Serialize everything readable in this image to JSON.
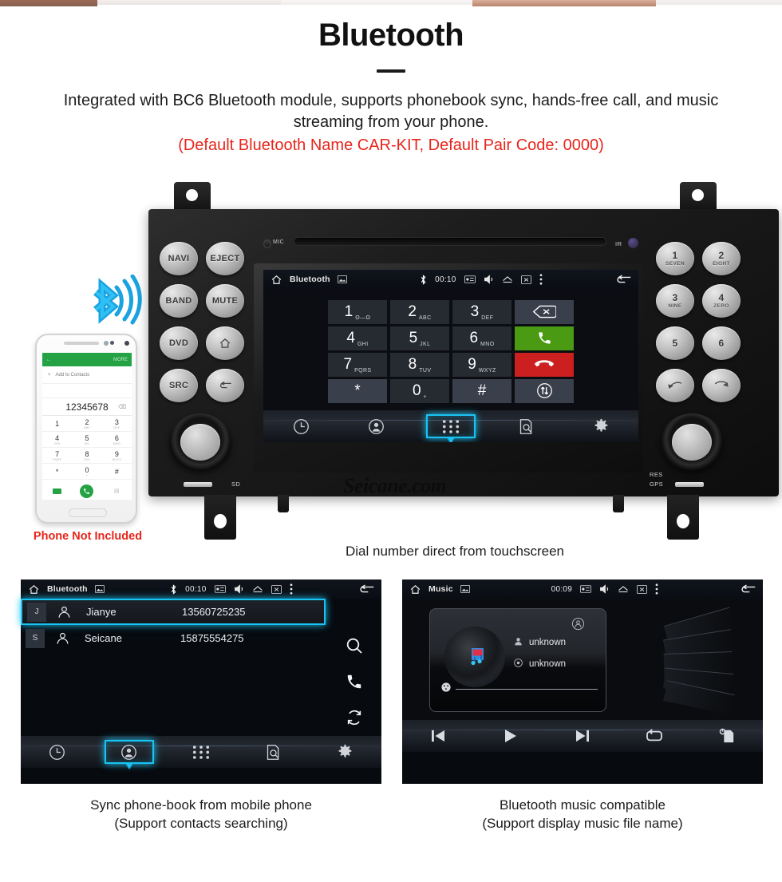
{
  "header": {
    "title": "Bluetooth",
    "subtitle_line1": "Integrated with BC6 Bluetooth module, supports phonebook sync, hands-free call, and",
    "subtitle_line2": "music streaming from your phone.",
    "subtitle_note": "(Default Bluetooth Name CAR-KIT, Default Pair Code: 0000)",
    "note_color": "#e8251b"
  },
  "phone_mockup": {
    "back_label": "←",
    "more_label": "MORE",
    "add_contact_label": "Add to Contacts",
    "dialed_number": "12345678",
    "delete_label": "⌫",
    "keys": [
      {
        "d": "1",
        "l": ""
      },
      {
        "d": "2",
        "l": "ABC"
      },
      {
        "d": "3",
        "l": "DEF"
      },
      {
        "d": "4",
        "l": "GHI"
      },
      {
        "d": "5",
        "l": "JKL"
      },
      {
        "d": "6",
        "l": "MNO"
      },
      {
        "d": "7",
        "l": "PQRS"
      },
      {
        "d": "8",
        "l": "TUV"
      },
      {
        "d": "9",
        "l": "WXYZ"
      },
      {
        "d": "*",
        "l": ""
      },
      {
        "d": "0",
        "l": "+"
      },
      {
        "d": "#",
        "l": ""
      }
    ],
    "not_included_note": "Phone Not Included"
  },
  "radio": {
    "mic_label": "MIC",
    "ir_label": "IR",
    "sd_label_left": "SD",
    "sd_label_right": "GPS",
    "res_label": "RES",
    "watermark": "Seicane.com",
    "left_buttons": [
      {
        "label": "NAVI",
        "icon": ""
      },
      {
        "label": "EJECT",
        "icon": ""
      },
      {
        "label": "BAND",
        "icon": ""
      },
      {
        "label": "MUTE",
        "icon": ""
      },
      {
        "label": "DVD",
        "icon": ""
      },
      {
        "label": "",
        "icon": "home-icon"
      },
      {
        "label": "SRC",
        "icon": ""
      },
      {
        "label": "",
        "icon": "back-icon"
      }
    ],
    "right_buttons": [
      {
        "num": "1",
        "sub": "SEVEN",
        "icon": ""
      },
      {
        "num": "2",
        "sub": "EIGHT",
        "icon": ""
      },
      {
        "num": "3",
        "sub": "NINE",
        "icon": ""
      },
      {
        "num": "4",
        "sub": "ZERO",
        "icon": ""
      },
      {
        "num": "5",
        "sub": "",
        "icon": ""
      },
      {
        "num": "6",
        "sub": "",
        "icon": ""
      },
      {
        "num": "",
        "sub": "",
        "icon": "call-answer-icon"
      },
      {
        "num": "",
        "sub": "",
        "icon": "call-end-icon"
      }
    ]
  },
  "main_screen": {
    "statusbar": {
      "title": "Bluetooth",
      "time": "00:10",
      "icons": [
        "home-icon",
        "gallery-icon",
        "bluetooth-icon",
        "radio-icon",
        "volume-icon",
        "eject-icon",
        "screen-off-icon",
        "overflow-menu-icon",
        "back-icon"
      ]
    },
    "dialpad": {
      "columns": [
        [
          {
            "d": "1",
            "l": "ʘ—ʘ"
          },
          {
            "d": "4",
            "l": "GHI"
          },
          {
            "d": "7",
            "l": "PQRS"
          },
          {
            "d": "*",
            "l": ""
          }
        ],
        [
          {
            "d": "2",
            "l": "ABC"
          },
          {
            "d": "5",
            "l": "JKL"
          },
          {
            "d": "8",
            "l": "TUV"
          },
          {
            "d": "0",
            "l": "+"
          }
        ],
        [
          {
            "d": "3",
            "l": "DEF"
          },
          {
            "d": "6",
            "l": "MNO"
          },
          {
            "d": "9",
            "l": "WXYZ"
          },
          {
            "d": "#",
            "l": ""
          }
        ]
      ],
      "actions": [
        {
          "name": "backspace-key",
          "style": "grey"
        },
        {
          "name": "call-answer-key",
          "style": "green"
        },
        {
          "name": "call-end-key",
          "style": "red"
        },
        {
          "name": "transfer-audio-key",
          "style": "grey"
        }
      ]
    },
    "navbar": {
      "items": [
        "recent-calls-icon",
        "contacts-icon",
        "dialpad-icon",
        "search-contacts-icon",
        "settings-icon"
      ],
      "selected_index": 2
    },
    "caption": "Dial number direct from touchscreen"
  },
  "phonebook_panel": {
    "statusbar": {
      "title": "Bluetooth",
      "time": "00:10"
    },
    "contacts": [
      {
        "badge": "J",
        "name": "Jianye",
        "number": "13560725235",
        "selected": true
      },
      {
        "badge": "S",
        "name": "Seicane",
        "number": "15875554275",
        "selected": false
      }
    ],
    "side_icons": [
      "search-icon",
      "call-icon",
      "sync-icon"
    ],
    "navbar": {
      "items": [
        "recent-calls-icon",
        "contacts-icon",
        "dialpad-icon",
        "search-contacts-icon",
        "settings-icon"
      ],
      "selected_index": 1
    },
    "caption_line1": "Sync phone-book from mobile phone",
    "caption_line2": "(Support contacts searching)"
  },
  "music_panel": {
    "statusbar": {
      "title": "Music",
      "time": "00:09"
    },
    "artist": "unknown",
    "album": "unknown",
    "controls": [
      "previous-track-icon",
      "play-icon",
      "next-track-icon",
      "repeat-icon",
      "playlist-icon"
    ],
    "caption_line1": "Bluetooth music compatible",
    "caption_line2": "(Support display music file name)"
  },
  "colors": {
    "accent_cyan": "#19c3f3",
    "call_green": "#4a9a14",
    "call_red": "#cc1f1f",
    "bluetooth_blue": "#1aa3e0",
    "note_red": "#e8251b"
  }
}
